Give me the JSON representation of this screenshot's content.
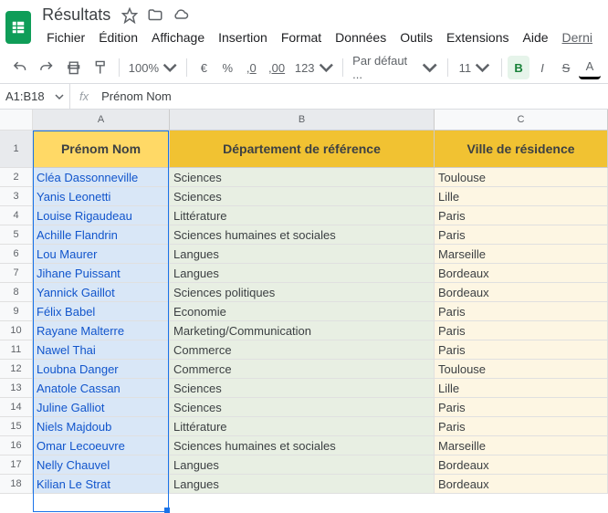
{
  "doc": {
    "title": "Résultats"
  },
  "menu": {
    "file": "Fichier",
    "edit": "Édition",
    "view": "Affichage",
    "insert": "Insertion",
    "format": "Format",
    "data": "Données",
    "tools": "Outils",
    "extensions": "Extensions",
    "help": "Aide",
    "last": "Derni"
  },
  "toolbar": {
    "zoom": "100%",
    "currency": "€",
    "percent": "%",
    "dec_dec": ",0",
    "dec_inc": ",00",
    "numfmt": "123",
    "font": "Par défaut ...",
    "size": "11",
    "bold": "B",
    "italic": "I",
    "strike": "S",
    "color": "A"
  },
  "namebox": {
    "ref": "A1:B18",
    "formula": "Prénom Nom",
    "fx": "fx"
  },
  "columns": {
    "a": "A",
    "b": "B",
    "c": "C"
  },
  "headers": {
    "a": "Prénom Nom",
    "b": "Département de référence",
    "c": "Ville de résidence"
  },
  "rows": [
    {
      "n": "2",
      "a": "Cléa Dassonneville",
      "b": "Sciences",
      "c": "Toulouse"
    },
    {
      "n": "3",
      "a": "Yanis Leonetti",
      "b": "Sciences",
      "c": "Lille"
    },
    {
      "n": "4",
      "a": "Louise Rigaudeau",
      "b": "Littérature",
      "c": "Paris"
    },
    {
      "n": "5",
      "a": "Achille Flandrin",
      "b": "Sciences humaines et sociales",
      "c": "Paris"
    },
    {
      "n": "6",
      "a": "Lou Maurer",
      "b": "Langues",
      "c": "Marseille"
    },
    {
      "n": "7",
      "a": "Jihane Puissant",
      "b": "Langues",
      "c": "Bordeaux"
    },
    {
      "n": "8",
      "a": "Yannick Gaillot",
      "b": "Sciences politiques",
      "c": "Bordeaux"
    },
    {
      "n": "9",
      "a": "Félix Babel",
      "b": "Economie",
      "c": "Paris"
    },
    {
      "n": "10",
      "a": "Rayane Malterre",
      "b": "Marketing/Communication",
      "c": "Paris"
    },
    {
      "n": "11",
      "a": "Nawel Thai",
      "b": "Commerce",
      "c": "Paris"
    },
    {
      "n": "12",
      "a": "Loubna Danger",
      "b": "Commerce",
      "c": "Toulouse"
    },
    {
      "n": "13",
      "a": "Anatole Cassan",
      "b": "Sciences",
      "c": "Lille"
    },
    {
      "n": "14",
      "a": "Juline Galliot",
      "b": "Sciences",
      "c": "Paris"
    },
    {
      "n": "15",
      "a": "Niels Majdoub",
      "b": "Littérature",
      "c": "Paris"
    },
    {
      "n": "16",
      "a": "Omar Lecoeuvre",
      "b": "Sciences humaines et sociales",
      "c": "Marseille"
    },
    {
      "n": "17",
      "a": "Nelly Chauvel",
      "b": "Langues",
      "c": "Bordeaux"
    },
    {
      "n": "18",
      "a": "Kilian Le Strat",
      "b": "Langues",
      "c": "Bordeaux"
    }
  ]
}
